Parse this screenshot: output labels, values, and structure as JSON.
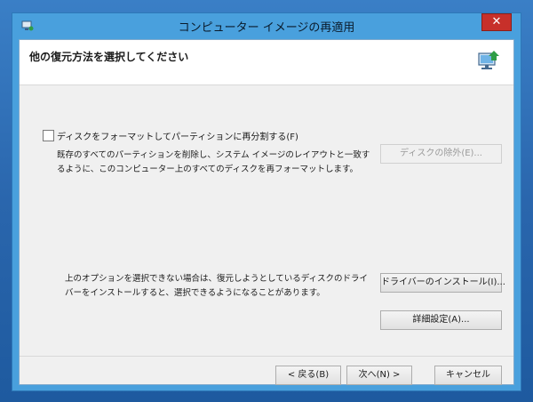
{
  "window": {
    "title": "コンピューター イメージの再適用",
    "close_glyph": "✕"
  },
  "header": {
    "title": "他の復元方法を選択してください",
    "icon": "computer-restore-icon"
  },
  "format_option": {
    "checkbox_label": "ディスクをフォーマットしてパーティションに再分割する(F)",
    "checked": false,
    "description": "既存のすべてのパーティションを削除し、システム イメージのレイアウトと一致するように、このコンピューター上のすべてのディスクを再フォーマットします。",
    "exclude_button": "ディスクの除外(E)..."
  },
  "driver": {
    "note": "上のオプションを選択できない場合は、復元しようとしているディスクのドライバーをインストールすると、選択できるようになることがあります。",
    "install_button": "ドライバーのインストール(I)..."
  },
  "advanced_button": "詳細設定(A)...",
  "footer": {
    "back": "< 戻る(B)",
    "next": "次へ(N) >",
    "cancel": "キャンセル"
  },
  "colors": {
    "desktop": "#2f6fb7",
    "window_frame": "#49a0dd",
    "close_button": "#c7302a"
  }
}
